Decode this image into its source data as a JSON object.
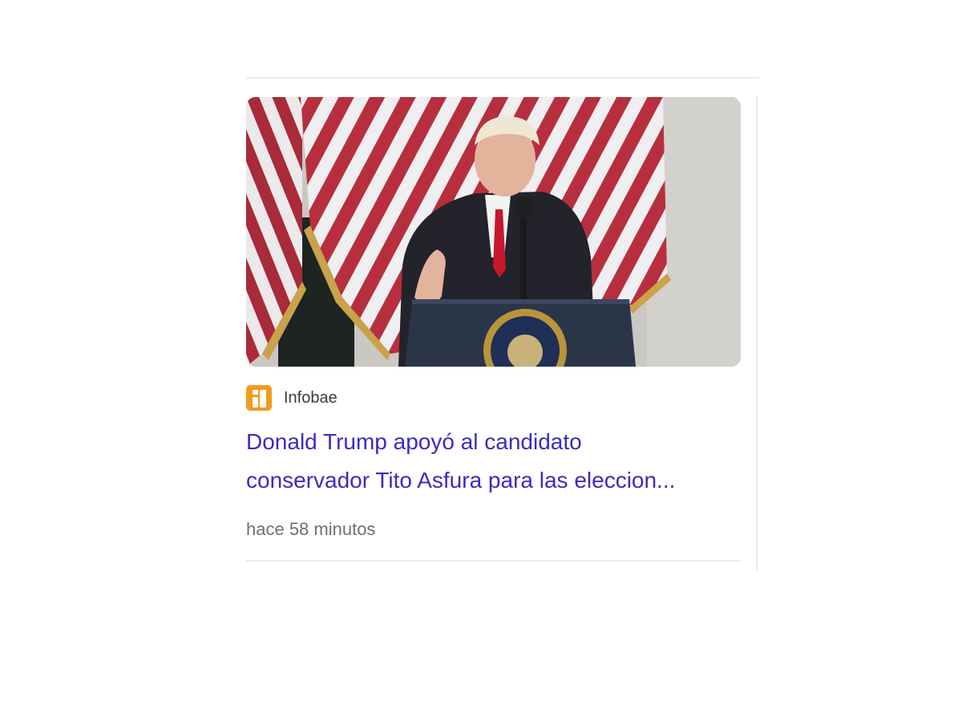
{
  "news_card": {
    "image_alt": "Donald Trump speaking at a podium in front of American flags",
    "source": {
      "name": "Infobae",
      "logo_icon": "infobae-logo-icon",
      "logo_color": "#f39a1e"
    },
    "headline": {
      "line1": "Donald Trump apoyó al candidato",
      "line2": "conservador Tito Asfura para las eleccion..."
    },
    "timestamp": "hace 58 minutos",
    "colors": {
      "headline": "#3a2cc0",
      "timestamp": "#6f6f6f",
      "divider": "#ebebeb"
    }
  }
}
